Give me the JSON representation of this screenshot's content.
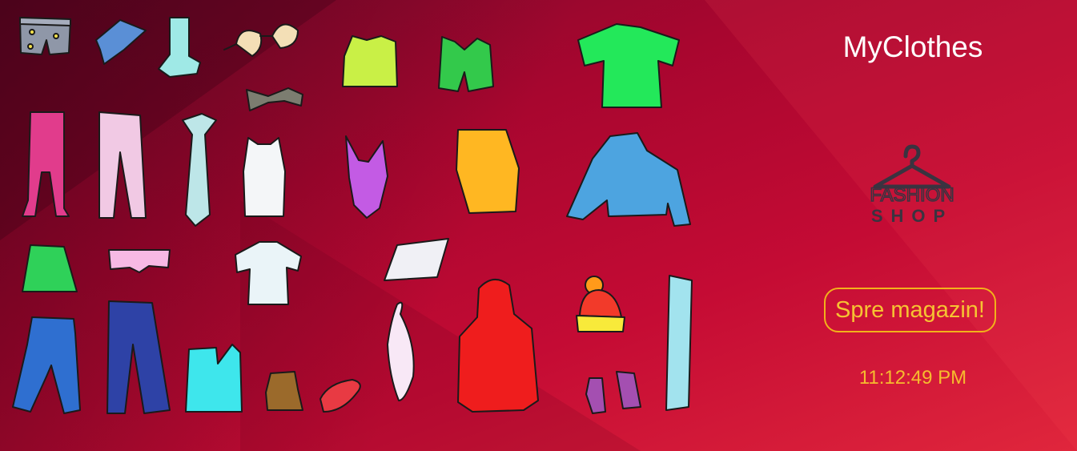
{
  "header": {
    "title": "MyClothes"
  },
  "logo": {
    "line1": "FASHION",
    "line2": "SHOP",
    "icon": "hanger-icon"
  },
  "actions": {
    "shop_label": "Spre magazin!"
  },
  "clock": {
    "time": "11:12:49 PM"
  },
  "colors": {
    "background_start": "#7a0a2c",
    "background_end": "#e0263c",
    "title": "#ffffff",
    "accent": "#f2b21a",
    "logo": "#3a3340"
  },
  "clothing_icons": [
    "shorts-icon",
    "scarf-icon",
    "sock-icon",
    "bra-icon",
    "bowtie-icon",
    "tank-top-icon",
    "vest-icon",
    "tshirt-icon",
    "tights-icon",
    "leggings-icon",
    "tie-icon",
    "undershirt-icon",
    "swimsuit-icon",
    "apron-icon",
    "sweater-icon",
    "skirt-icon",
    "underwear-icon",
    "shirt-icon",
    "handkerchief-icon",
    "beanie-icon",
    "jeans-icon",
    "trousers-icon",
    "boot-icon",
    "shoe-icon",
    "flat-shoe-icon",
    "napkin-icon",
    "hoodie-icon",
    "mittens-icon",
    "long-scarf-icon"
  ]
}
